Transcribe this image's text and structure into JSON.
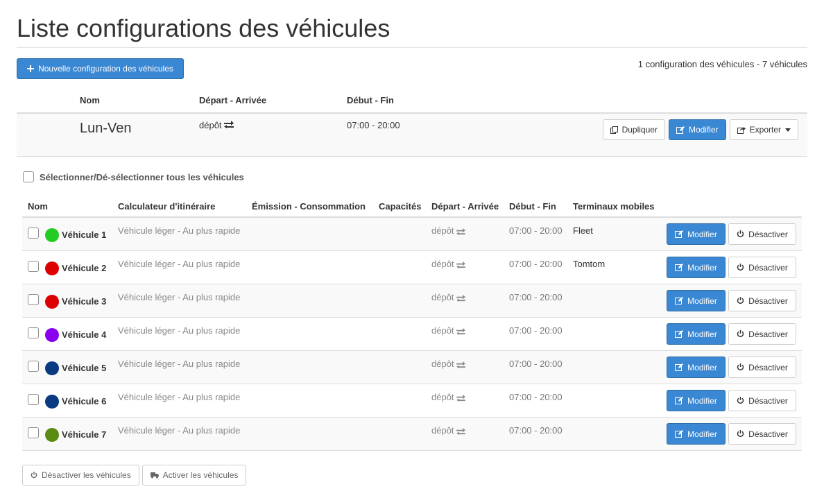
{
  "page": {
    "title": "Liste configurations des véhicules"
  },
  "toolbar": {
    "new_config_label": "Nouvelle configuration des véhicules",
    "summary": "1 configuration des véhicules - 7 véhicules"
  },
  "config_table": {
    "headers": {
      "name": "Nom",
      "depart": "Départ - Arrivée",
      "time": "Début - Fin"
    },
    "row": {
      "name": "Lun-Ven",
      "depart": "dépôt",
      "time": "07:00 - 20:00",
      "duplicate_label": "Dupliquer",
      "edit_label": "Modifier",
      "export_label": "Exporter"
    }
  },
  "select_all_label": "Sélectionner/Dé-sélectionner tous les véhicules",
  "vehicle_table": {
    "headers": {
      "name": "Nom",
      "router": "Calculateur d'itinéraire",
      "emission": "Émission - Consommation",
      "capacities": "Capacités",
      "depart": "Départ - Arrivée",
      "time": "Début - Fin",
      "terminals": "Terminaux mobiles"
    },
    "edit_label": "Modifier",
    "deactivate_label": "Désactiver",
    "rows": [
      {
        "name": "Véhicule 1",
        "color": "#22cc22",
        "router": "Véhicule léger - Au plus rapide",
        "depart": "dépôt",
        "time": "07:00 - 20:00",
        "terminal": "Fleet"
      },
      {
        "name": "Véhicule 2",
        "color": "#dd0000",
        "router": "Véhicule léger - Au plus rapide",
        "depart": "dépôt",
        "time": "07:00 - 20:00",
        "terminal": "Tomtom"
      },
      {
        "name": "Véhicule 3",
        "color": "#dd0000",
        "router": "Véhicule léger - Au plus rapide",
        "depart": "dépôt",
        "time": "07:00 - 20:00",
        "terminal": ""
      },
      {
        "name": "Véhicule 4",
        "color": "#8800ee",
        "router": "Véhicule léger - Au plus rapide",
        "depart": "dépôt",
        "time": "07:00 - 20:00",
        "terminal": ""
      },
      {
        "name": "Véhicule 5",
        "color": "#0a3a82",
        "router": "Véhicule léger - Au plus rapide",
        "depart": "dépôt",
        "time": "07:00 - 20:00",
        "terminal": ""
      },
      {
        "name": "Véhicule 6",
        "color": "#0a3a82",
        "router": "Véhicule léger - Au plus rapide",
        "depart": "dépôt",
        "time": "07:00 - 20:00",
        "terminal": ""
      },
      {
        "name": "Véhicule 7",
        "color": "#5a8a12",
        "router": "Véhicule léger - Au plus rapide",
        "depart": "dépôt",
        "time": "07:00 - 20:00",
        "terminal": ""
      }
    ]
  },
  "bottom_actions": {
    "deactivate_all_label": "Désactiver les véhicules",
    "activate_all_label": "Activer les véhicules"
  },
  "icons": {
    "plus": "plus-icon",
    "exchange": "exchange-icon",
    "copy": "copy-icon",
    "edit": "edit-icon",
    "share": "share-icon",
    "caret": "caret-down-icon",
    "power": "power-icon",
    "truck": "truck-icon"
  }
}
